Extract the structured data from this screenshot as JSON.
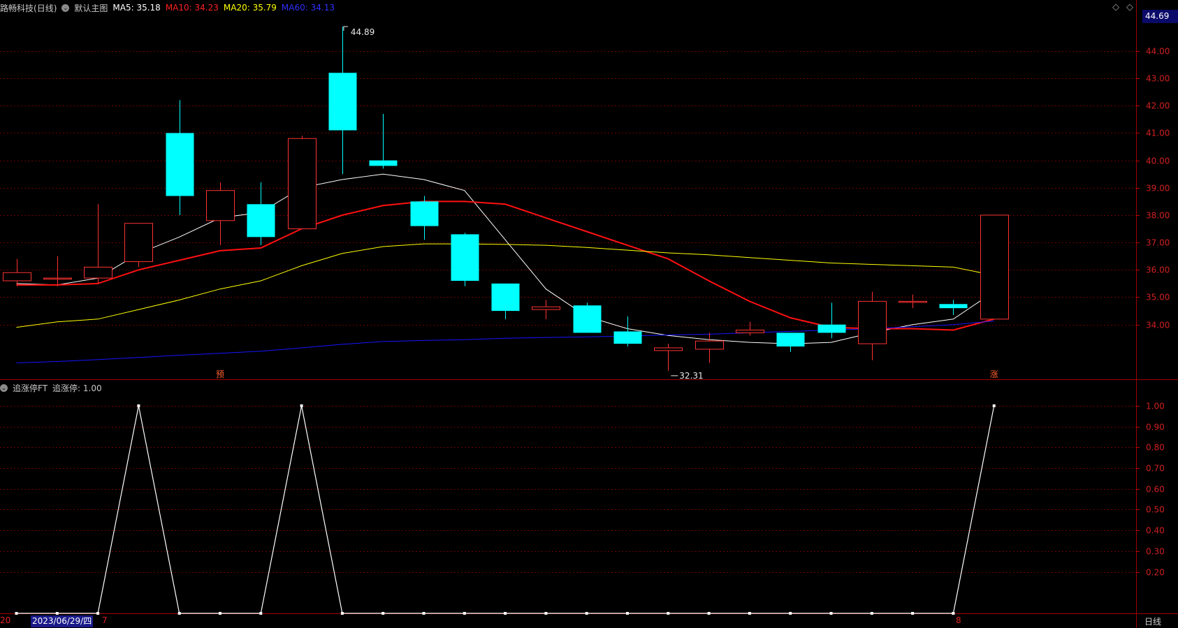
{
  "header": {
    "stock_name": "路畅科技",
    "period_tag": "(日线)",
    "formula_name": "默认主图",
    "ma5": {
      "label": "MA5: 35.18",
      "color": "#ffffff"
    },
    "ma10": {
      "label": "MA10: 34.23",
      "color": "#ff2020"
    },
    "ma20": {
      "label": "MA20: 35.79",
      "color": "#ffff00"
    },
    "ma60": {
      "label": "MA60: 34.13",
      "color": "#2020ff"
    }
  },
  "sub_header": {
    "indicator_name": "追涨停FT",
    "value_label": "追涨停: 1.00"
  },
  "current_price": "44.69",
  "high_label": "44.89",
  "low_label": "32.31",
  "marker_yu": "预",
  "marker_zhang": "涨",
  "x_axis": {
    "left_partial": "20",
    "date_label": "2023/06/29/四",
    "tick_7": "7",
    "tick_8": "8",
    "period_label": "日线"
  },
  "colors": {
    "up": "#ff3232",
    "down": "#00ffff",
    "grid": "#6e0000",
    "axis_text": "#d02020"
  },
  "chart_data": [
    {
      "type": "candlestick",
      "y_ticks": [
        "44.00",
        "43.00",
        "42.00",
        "41.00",
        "40.00",
        "39.00",
        "38.00",
        "37.00",
        "36.00",
        "35.00",
        "34.00"
      ],
      "ylim": [
        32.0,
        45.3
      ],
      "candles": [
        {
          "o": 35.6,
          "h": 36.4,
          "l": 35.4,
          "c": 35.9
        },
        {
          "o": 35.7,
          "h": 36.5,
          "l": 35.4,
          "c": 35.7
        },
        {
          "o": 35.7,
          "h": 38.4,
          "l": 35.5,
          "c": 36.1
        },
        {
          "o": 36.3,
          "h": 37.7,
          "l": 36.1,
          "c": 37.7
        },
        {
          "o": 41.0,
          "h": 42.2,
          "l": 38.0,
          "c": 38.7
        },
        {
          "o": 37.8,
          "h": 39.2,
          "l": 36.9,
          "c": 38.9
        },
        {
          "o": 38.4,
          "h": 39.2,
          "l": 36.9,
          "c": 37.2
        },
        {
          "o": 37.5,
          "h": 40.9,
          "l": 37.5,
          "c": 40.8
        },
        {
          "o": 43.2,
          "h": 44.89,
          "l": 39.5,
          "c": 41.1
        },
        {
          "o": 40.0,
          "h": 41.7,
          "l": 39.7,
          "c": 39.8
        },
        {
          "o": 38.5,
          "h": 38.7,
          "l": 37.1,
          "c": 37.6
        },
        {
          "o": 37.3,
          "h": 37.35,
          "l": 35.4,
          "c": 35.6
        },
        {
          "o": 35.5,
          "h": 35.5,
          "l": 34.2,
          "c": 34.5
        },
        {
          "o": 34.55,
          "h": 34.9,
          "l": 34.2,
          "c": 34.65
        },
        {
          "o": 34.7,
          "h": 34.8,
          "l": 33.7,
          "c": 33.7
        },
        {
          "o": 33.75,
          "h": 34.3,
          "l": 33.2,
          "c": 33.3
        },
        {
          "o": 33.05,
          "h": 33.3,
          "l": 32.31,
          "c": 33.15
        },
        {
          "o": 33.1,
          "h": 33.7,
          "l": 32.6,
          "c": 33.4
        },
        {
          "o": 33.7,
          "h": 34.1,
          "l": 33.6,
          "c": 33.8
        },
        {
          "o": 33.7,
          "h": 33.7,
          "l": 33.0,
          "c": 33.2
        },
        {
          "o": 34.0,
          "h": 34.8,
          "l": 33.5,
          "c": 33.7
        },
        {
          "o": 33.3,
          "h": 35.2,
          "l": 32.7,
          "c": 34.85
        },
        {
          "o": 34.85,
          "h": 35.1,
          "l": 34.6,
          "c": 34.85
        },
        {
          "o": 34.75,
          "h": 34.9,
          "l": 34.35,
          "c": 34.6
        },
        {
          "o": 34.2,
          "h": 38.0,
          "l": 34.2,
          "c": 38.0
        }
      ],
      "series": [
        {
          "name": "MA5",
          "color": "#ffffff",
          "width": 1,
          "values": [
            35.5,
            35.45,
            35.7,
            36.6,
            37.2,
            37.9,
            38.1,
            39.0,
            39.3,
            39.5,
            39.3,
            38.9,
            37.1,
            35.3,
            34.3,
            33.85,
            33.6,
            33.45,
            33.35,
            33.3,
            33.35,
            33.7,
            34.0,
            34.2,
            35.2
          ]
        },
        {
          "name": "MA10",
          "color": "#ff1010",
          "width": 2,
          "values": [
            35.45,
            35.45,
            35.5,
            36.0,
            36.35,
            36.7,
            36.8,
            37.5,
            38.0,
            38.35,
            38.5,
            38.5,
            38.4,
            37.9,
            37.4,
            36.9,
            36.4,
            35.6,
            34.85,
            34.25,
            33.9,
            33.85,
            33.85,
            33.8,
            34.2
          ]
        },
        {
          "name": "MA20",
          "color": "#ffff00",
          "width": 1,
          "values": [
            33.9,
            34.1,
            34.2,
            34.55,
            34.9,
            35.3,
            35.6,
            36.15,
            36.6,
            36.85,
            36.95,
            36.95,
            36.93,
            36.9,
            36.82,
            36.72,
            36.62,
            36.55,
            36.45,
            36.35,
            36.25,
            36.2,
            36.15,
            36.1,
            35.8
          ]
        },
        {
          "name": "MA60",
          "color": "#1515ff",
          "width": 1,
          "values": [
            32.6,
            32.65,
            32.72,
            32.8,
            32.88,
            32.95,
            33.03,
            33.15,
            33.28,
            33.38,
            33.42,
            33.45,
            33.5,
            33.53,
            33.55,
            33.58,
            33.62,
            33.65,
            33.7,
            33.75,
            33.8,
            33.85,
            33.92,
            34.0,
            34.13
          ]
        }
      ]
    },
    {
      "type": "line",
      "y_ticks": [
        "1.00",
        "0.90",
        "0.80",
        "0.70",
        "0.60",
        "0.50",
        "0.40",
        "0.30",
        "0.20"
      ],
      "ylim": [
        0.0,
        1.05
      ],
      "series": [
        {
          "name": "追涨停",
          "color": "#ffffff",
          "values": [
            0,
            0,
            0,
            1,
            0,
            0,
            0,
            1,
            0,
            0,
            0,
            0,
            0,
            0,
            0,
            0,
            0,
            0,
            0,
            0,
            0,
            0,
            0,
            0,
            1
          ]
        }
      ]
    }
  ]
}
